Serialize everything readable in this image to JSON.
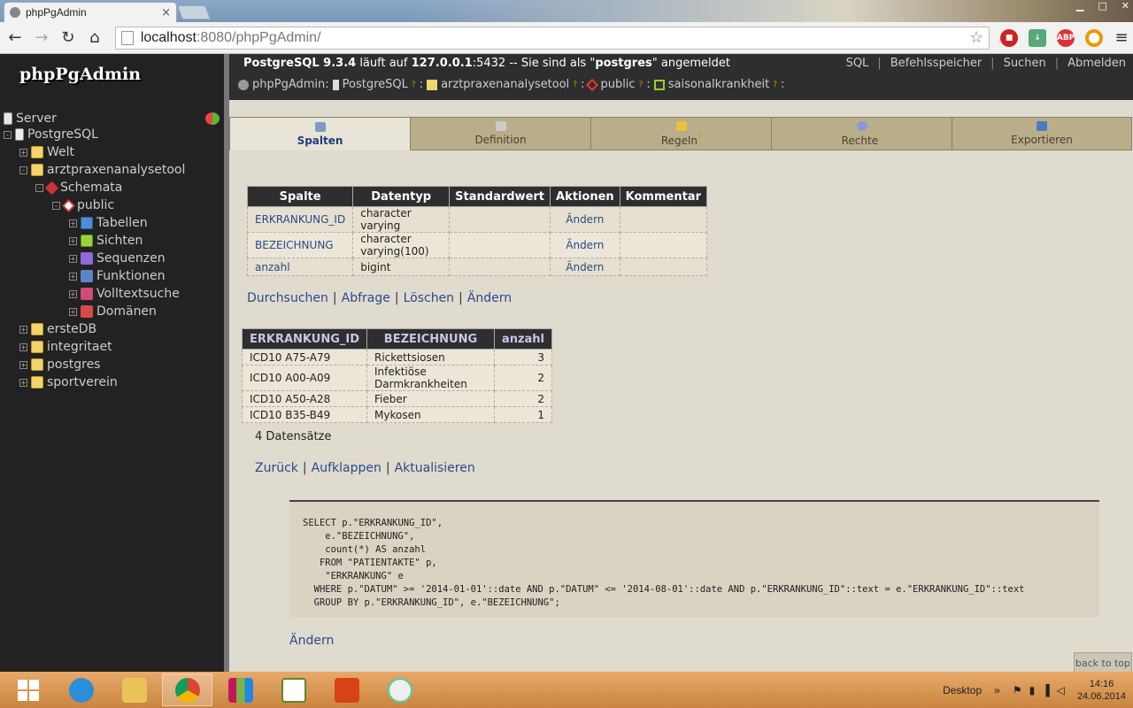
{
  "browser": {
    "tab_title": "phpPgAdmin",
    "url_host": "localhost",
    "url_rest": ":8080/phpPgAdmin/",
    "tab_close": "×"
  },
  "sidebar": {
    "brand": "phpPgAdmin",
    "tree": [
      {
        "label": "Server",
        "icon": "server-icon"
      },
      {
        "label": "PostgreSQL",
        "icon": "postgresql-icon"
      },
      {
        "label": "Welt",
        "icon": "database-icon"
      },
      {
        "label": "arztpraxenanalysetool",
        "icon": "database-icon"
      },
      {
        "label": "Schemata",
        "icon": "schemas-icon"
      },
      {
        "label": "public",
        "icon": "schema-icon"
      },
      {
        "label": "Tabellen",
        "icon": "tables-icon"
      },
      {
        "label": "Sichten",
        "icon": "views-icon"
      },
      {
        "label": "Sequenzen",
        "icon": "sequences-icon"
      },
      {
        "label": "Funktionen",
        "icon": "functions-icon"
      },
      {
        "label": "Volltextsuche",
        "icon": "fulltext-icon"
      },
      {
        "label": "Domänen",
        "icon": "domains-icon"
      },
      {
        "label": "ersteDB",
        "icon": "database-icon"
      },
      {
        "label": "integritaet",
        "icon": "database-icon"
      },
      {
        "label": "postgres",
        "icon": "database-icon"
      },
      {
        "label": "sportverein",
        "icon": "database-icon"
      }
    ]
  },
  "topbar": {
    "server_name": "PostgreSQL 9.3.4",
    "runs_on": " läuft auf ",
    "host": "127.0.0.1",
    "port_text": ":5432 -- Sie sind als \"",
    "user": "postgres",
    "logged_in": "\" angemeldet",
    "links": [
      "SQL",
      "Befehlsspeicher",
      "Suchen",
      "Abmelden"
    ],
    "crumbs": [
      "phpPgAdmin:",
      "PostgreSQL",
      "arztpraxenanalysetool",
      "public",
      "saisonalkrankheit"
    ]
  },
  "tabs": [
    {
      "label": "Spalten",
      "active": true,
      "help": ""
    },
    {
      "label": "Definition",
      "active": false,
      "help": ""
    },
    {
      "label": "Regeln",
      "active": false,
      "help": "?"
    },
    {
      "label": "Rechte",
      "active": false,
      "help": "?"
    },
    {
      "label": "Exportieren",
      "active": false,
      "help": ""
    }
  ],
  "columns_table": {
    "headers": [
      "Spalte",
      "Datentyp",
      "Standardwert",
      "Aktionen",
      "Kommentar"
    ],
    "rows": [
      {
        "name": "ERKRANKUNG_ID",
        "type": "character varying",
        "default": "",
        "action": "Ändern",
        "comment": ""
      },
      {
        "name": "BEZEICHNUNG",
        "type": "character varying(100)",
        "default": "",
        "action": "Ändern",
        "comment": ""
      },
      {
        "name": "anzahl",
        "type": "bigint",
        "default": "",
        "action": "Ändern",
        "comment": ""
      }
    ]
  },
  "view_actions": [
    "Durchsuchen",
    "Abfrage",
    "Löschen",
    "Ändern"
  ],
  "results_table": {
    "headers": [
      "ERKRANKUNG_ID",
      "BEZEICHNUNG",
      "anzahl"
    ],
    "rows": [
      [
        "ICD10 A75-A79",
        "Rickettsiosen",
        "3"
      ],
      [
        "ICD10 A00-A09",
        "Infektiöse Darmkrankheiten",
        "2"
      ],
      [
        "ICD10 A50-A28",
        "Fieber",
        "2"
      ],
      [
        "ICD10 B35-B49",
        "Mykosen",
        "1"
      ]
    ]
  },
  "row_count": "4 Datensätze",
  "result_actions": [
    "Zurück",
    "Aufklappen",
    "Aktualisieren"
  ],
  "sql_definition": "SELECT p.\"ERKRANKUNG_ID\",\n    e.\"BEZEICHNUNG\",\n    count(*) AS anzahl\n   FROM \"PATIENTAKTE\" p,\n    \"ERKRANKUNG\" e\n  WHERE p.\"DATUM\" >= '2014-01-01'::date AND p.\"DATUM\" <= '2014-08-01'::date AND p.\"ERKRANKUNG_ID\"::text = e.\"ERKRANKUNG_ID\"::text\n  GROUP BY p.\"ERKRANKUNG_ID\", e.\"BEZEICHNUNG\";",
  "edit_link": "Ändern",
  "back_to_top": "back to top",
  "taskbar": {
    "desktop_label": "Desktop",
    "chevron": "»",
    "time": "14:16",
    "date": "24.06.2014"
  }
}
